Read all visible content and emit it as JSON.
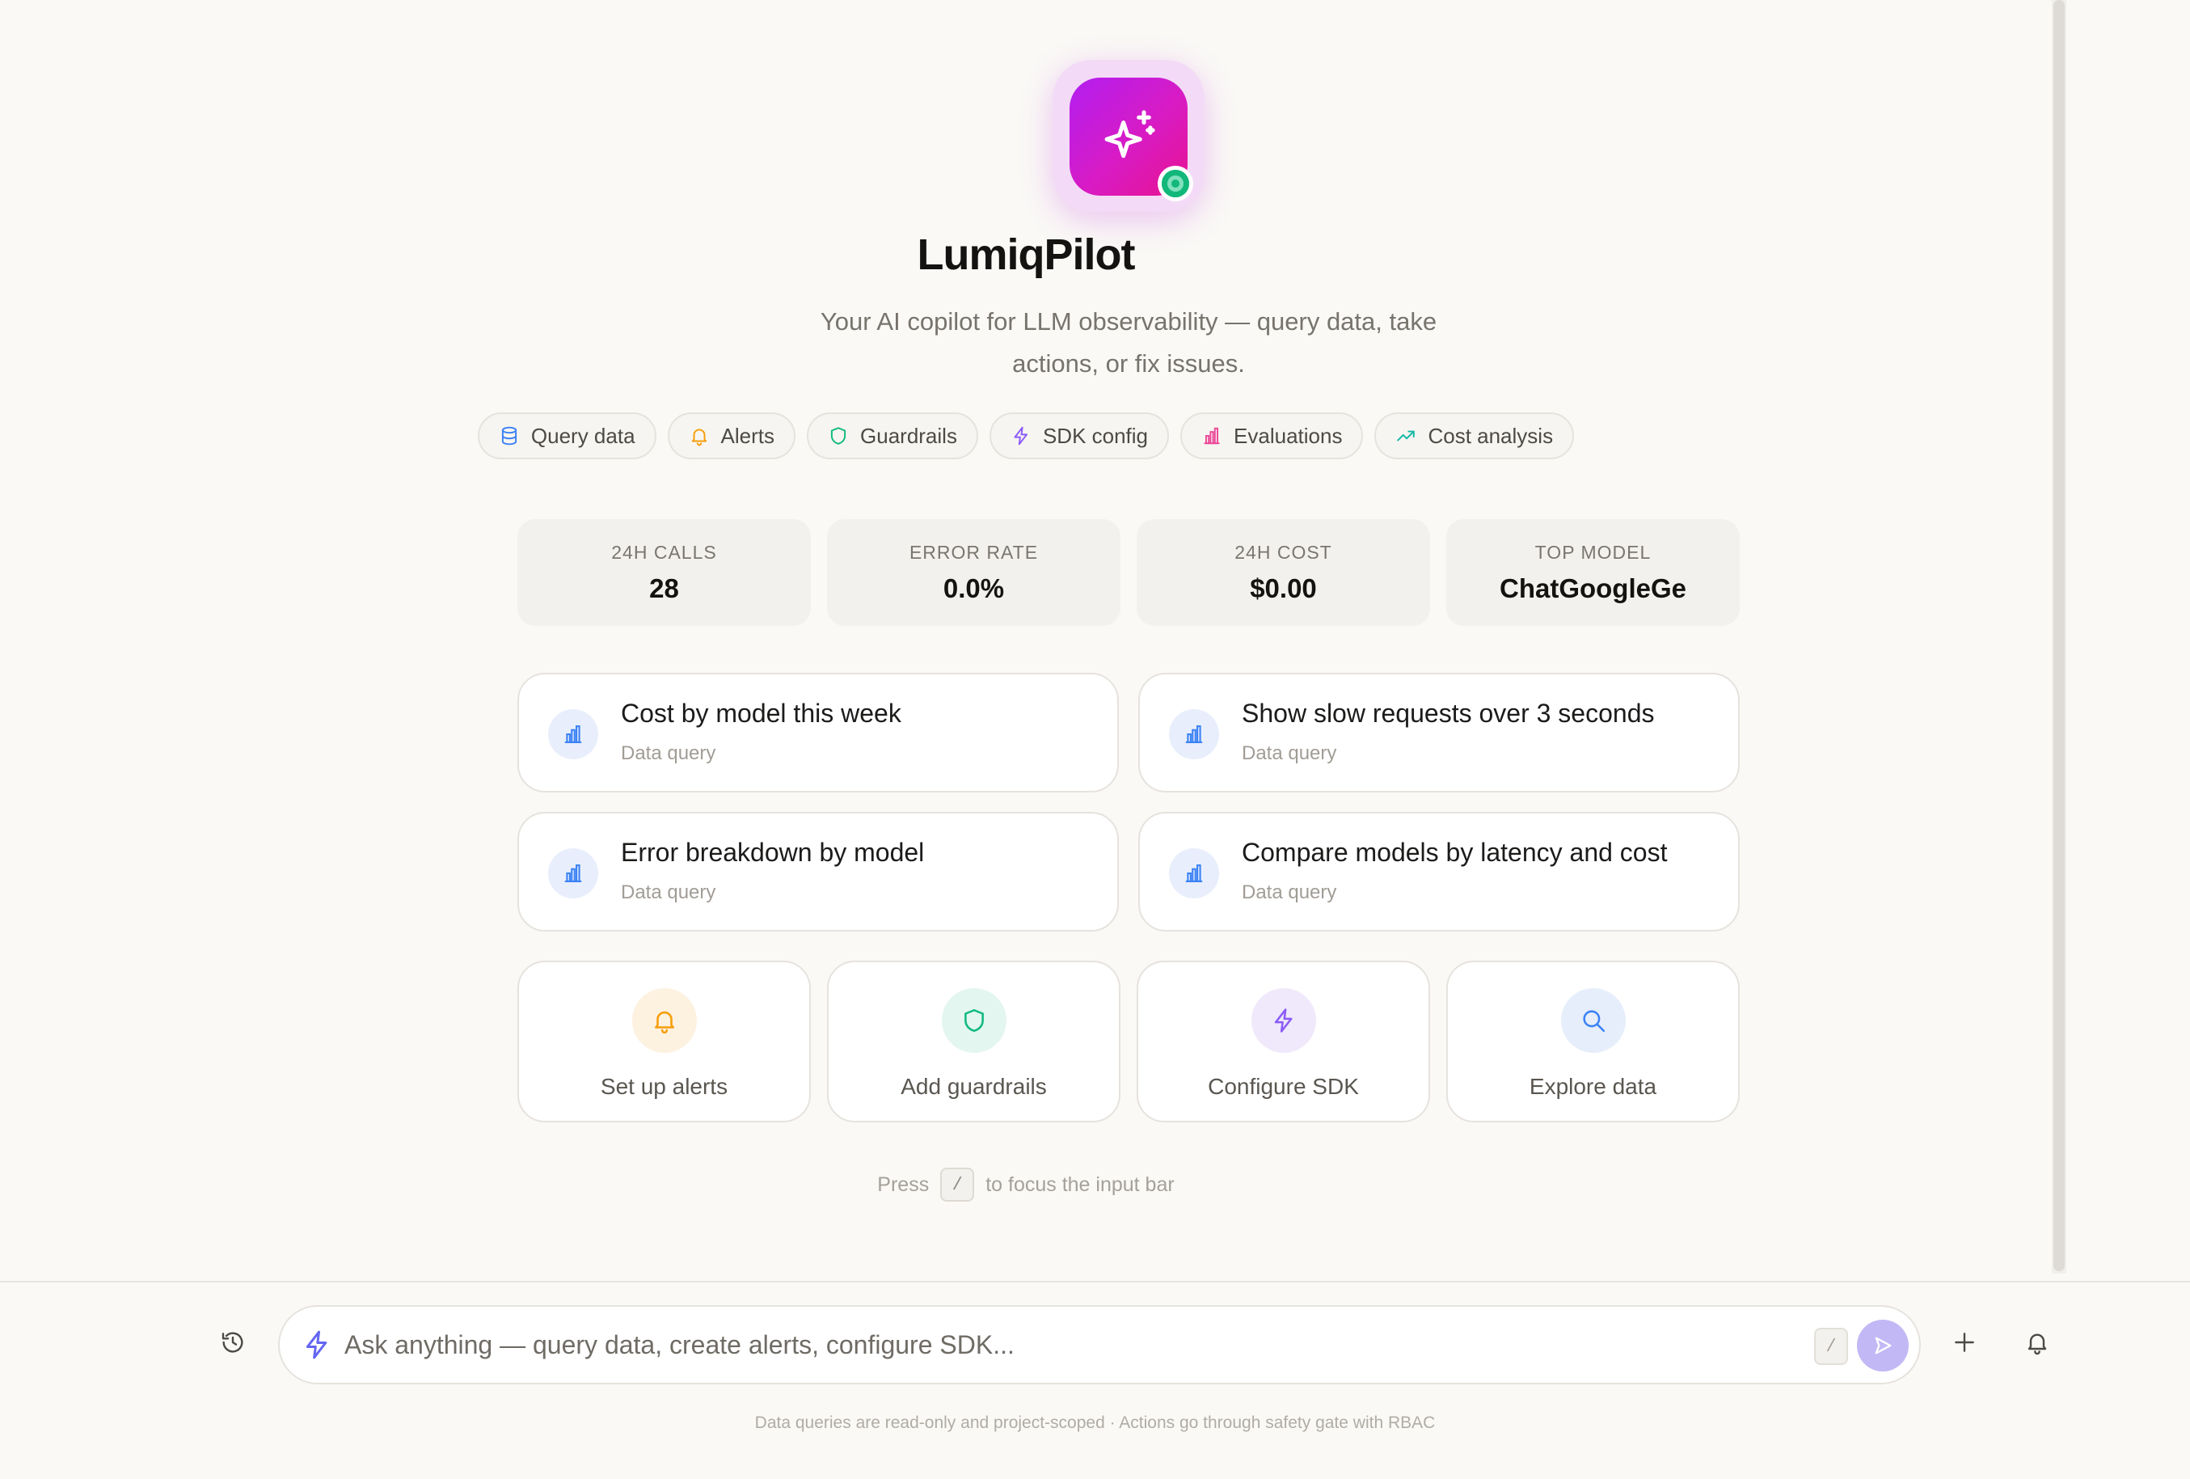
{
  "app": {
    "title": "LumiqPilot",
    "subtitle": "Your AI copilot for LLM observability — query data, take actions, or fix issues.",
    "brand_gradient": [
      "#b21ef0",
      "#e8138f"
    ],
    "status_color": "#12b77a"
  },
  "chips": [
    {
      "label": "Query data",
      "icon": "database-icon",
      "color": "#3b82f6"
    },
    {
      "label": "Alerts",
      "icon": "bell-icon",
      "color": "#f59e0b"
    },
    {
      "label": "Guardrails",
      "icon": "shield-icon",
      "color": "#10b981"
    },
    {
      "label": "SDK config",
      "icon": "bolt-icon",
      "color": "#8b5cf6"
    },
    {
      "label": "Evaluations",
      "icon": "bar-chart-icon",
      "color": "#ec4899"
    },
    {
      "label": "Cost analysis",
      "icon": "trending-up-icon",
      "color": "#14b8a6"
    }
  ],
  "stats": [
    {
      "label": "24H CALLS",
      "value": "28"
    },
    {
      "label": "ERROR RATE",
      "value": "0.0%"
    },
    {
      "label": "24H COST",
      "value": "$0.00"
    },
    {
      "label": "TOP MODEL",
      "value": "ChatGoogleGe"
    }
  ],
  "suggestions": [
    {
      "title": "Cost by model this week",
      "subtitle": "Data query"
    },
    {
      "title": "Show slow requests over 3 seconds",
      "subtitle": "Data query"
    },
    {
      "title": "Error breakdown by model",
      "subtitle": "Data query"
    },
    {
      "title": "Compare models by latency and cost",
      "subtitle": "Data query"
    }
  ],
  "actions": [
    {
      "label": "Set up alerts",
      "icon": "bell-icon",
      "color": "#f59e0b",
      "bg": "#fdf1e0"
    },
    {
      "label": "Add guardrails",
      "icon": "shield-icon",
      "color": "#10b981",
      "bg": "#e3f6ef"
    },
    {
      "label": "Configure SDK",
      "icon": "bolt-icon",
      "color": "#8b5cf6",
      "bg": "#efe9fb"
    },
    {
      "label": "Explore data",
      "icon": "search-icon",
      "color": "#3b82f6",
      "bg": "#e6eefb"
    }
  ],
  "hint": {
    "before": "Press",
    "key": "/",
    "after": "to focus the input bar"
  },
  "input": {
    "placeholder": "Ask anything — query data, create alerts, configure SDK...",
    "value": "",
    "shortcut": "/"
  },
  "footer_note": "Data queries are read-only and project-scoped · Actions go through safety gate with RBAC"
}
